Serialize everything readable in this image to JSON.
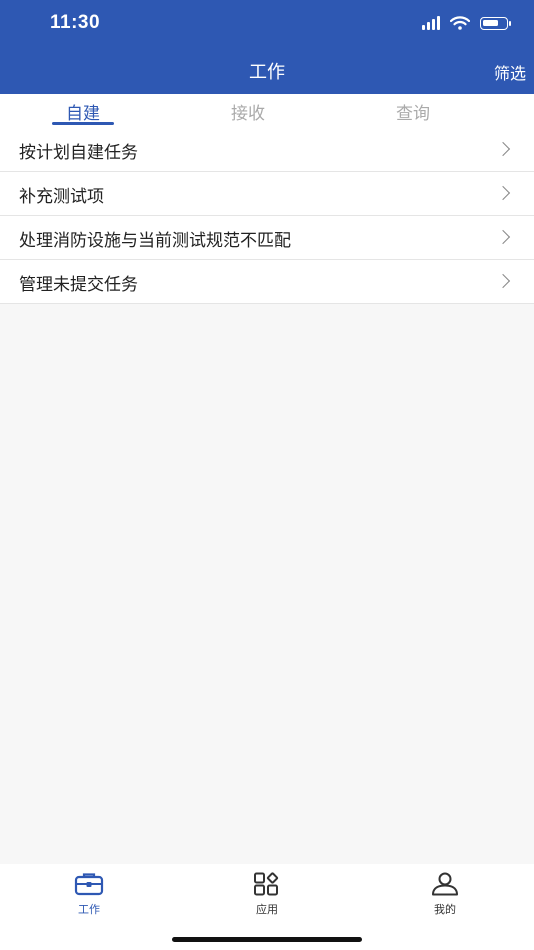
{
  "status_bar": {
    "time": "11:30",
    "icons": [
      "cellular-signal-icon",
      "wifi-icon",
      "battery-icon"
    ]
  },
  "nav": {
    "title": "工作",
    "action_label": "筛选"
  },
  "tabs": [
    {
      "label": "自建",
      "active": true
    },
    {
      "label": "接收",
      "active": false
    },
    {
      "label": "查询",
      "active": false
    }
  ],
  "list": [
    {
      "label": "按计划自建任务"
    },
    {
      "label": "补充测试项"
    },
    {
      "label": "处理消防设施与当前测试规范不匹配"
    },
    {
      "label": "管理未提交任务"
    }
  ],
  "tabbar": [
    {
      "label": "工作",
      "icon": "briefcase-icon",
      "active": true
    },
    {
      "label": "应用",
      "icon": "apps-grid-icon",
      "active": false
    },
    {
      "label": "我的",
      "icon": "user-icon",
      "active": false
    }
  ],
  "colors": {
    "primary": "#2e58b3",
    "inactive_tab": "#aaaaaa",
    "background": "#f7f7f7"
  }
}
